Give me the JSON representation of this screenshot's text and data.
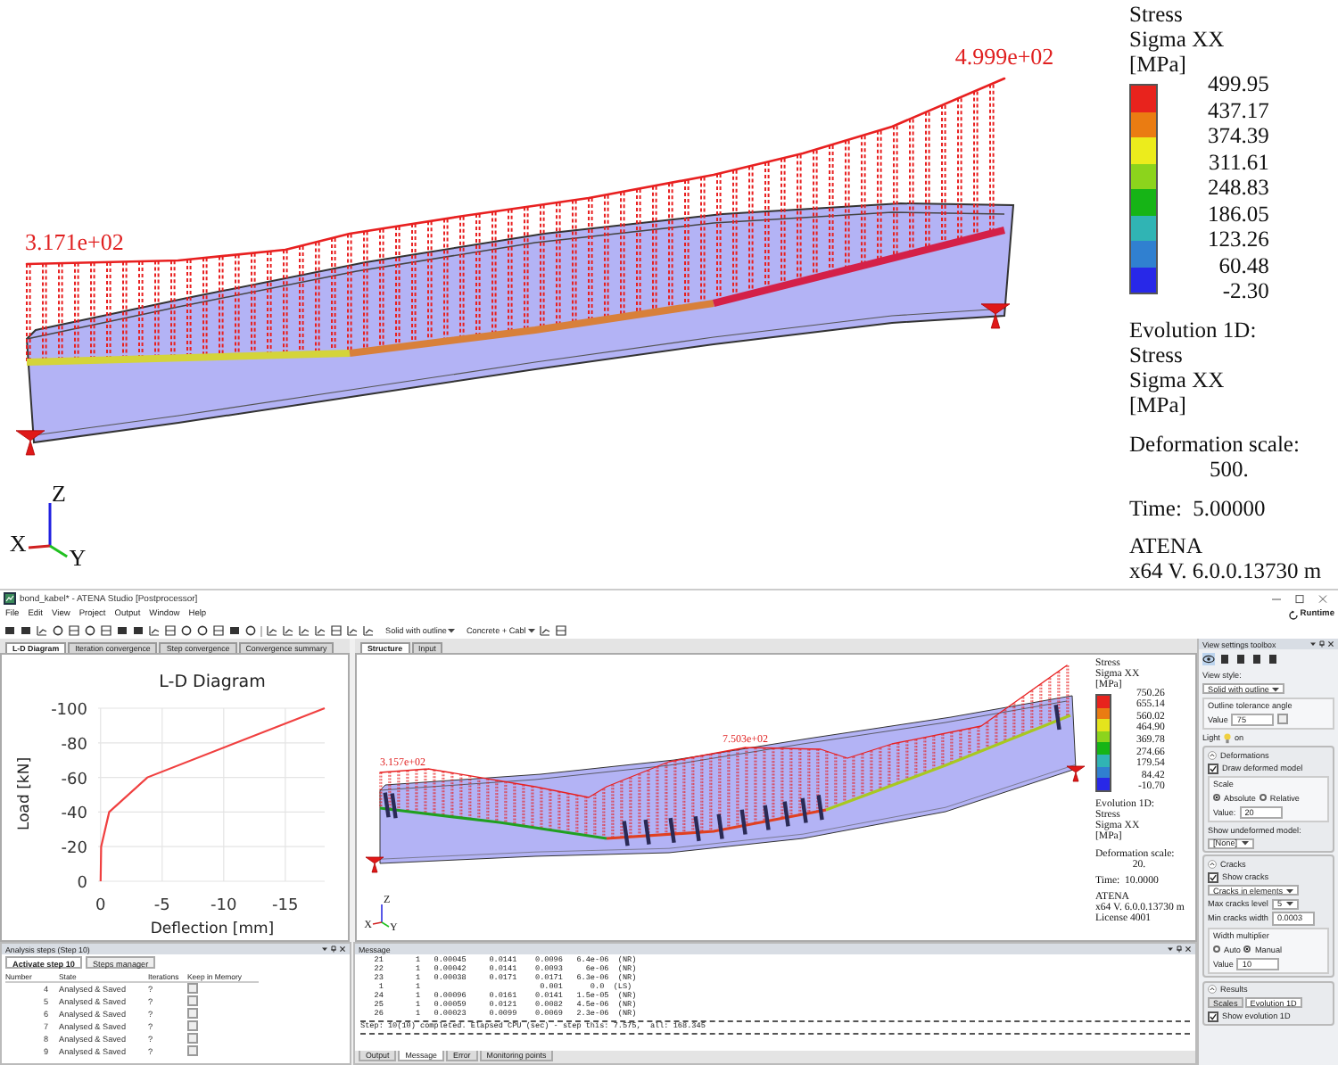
{
  "overview": {
    "viewport": {
      "start_label": "3.171e+02",
      "end_label": "4.999e+02",
      "axes": {
        "z": "Z",
        "x": "X",
        "y": "Y"
      }
    },
    "legend": {
      "title": [
        "Stress",
        "Sigma XX",
        "[MPa]"
      ],
      "values": [
        "499.95",
        "437.17",
        "374.39",
        "311.61",
        "248.83",
        "186.05",
        "123.26",
        "60.48",
        "-2.30"
      ],
      "bands": [
        {
          "color": "#e8231d"
        },
        {
          "color": "#ea7c12"
        },
        {
          "color": "#ecec1c"
        },
        {
          "color": "#8cd41c"
        },
        {
          "color": "#16b416"
        },
        {
          "color": "#30b4b4"
        },
        {
          "color": "#3080d0"
        },
        {
          "color": "#2828e8"
        }
      ],
      "evolution": [
        "Evolution 1D:",
        "Stress",
        "Sigma XX",
        "[MPa]"
      ],
      "deformation_label": "Deformation scale:",
      "deformation_value": "500.",
      "time": "Time:  5.00000",
      "info": [
        "ATENA",
        "x64 V. 6.0.0.13730 m"
      ]
    }
  },
  "app": {
    "window": {
      "title": "bond_kabel* - ATENA Studio [Postprocessor]"
    },
    "menu": [
      "File",
      "Edit",
      "View",
      "Project",
      "Output",
      "Window",
      "Help"
    ],
    "runtime": "Runtime",
    "toolbar": {
      "view_style": "Solid with outline",
      "material": "Concrete + Cabl"
    },
    "left_tabs": [
      {
        "label": "L-D Diagram",
        "selected": true
      },
      {
        "label": "Iteration convergence",
        "selected": false
      },
      {
        "label": "Step convergence",
        "selected": false
      },
      {
        "label": "Convergence summary",
        "selected": false
      }
    ],
    "ld_chart": {
      "chart_data": {
        "type": "line",
        "title": "L-D Diagram",
        "xlabel": "Deflection [mm]",
        "ylabel": "Load [kN]",
        "x": [
          0,
          -0.05,
          -0.7,
          -3.8,
          -18.2
        ],
        "values": [
          0,
          -20,
          -40,
          -60,
          -100
        ],
        "xlim": [
          0.2,
          -18.2
        ],
        "ylim": [
          0,
          -100
        ],
        "xticks": [
          0,
          -5,
          -10,
          -15
        ],
        "yticks": [
          0,
          -20,
          -40,
          -60,
          -80,
          -100
        ],
        "grid": true
      }
    },
    "structure_tabs": [
      {
        "label": "Structure",
        "selected": true
      },
      {
        "label": "Input",
        "selected": false
      }
    ],
    "structure_view": {
      "start_label": "3.157e+02",
      "peak_label": "7.503e+02",
      "axes": {
        "z": "Z",
        "x": "X",
        "y": "Y"
      },
      "legend": {
        "title": [
          "Stress",
          "Sigma XX",
          "[MPa]"
        ],
        "values": [
          "750.26",
          "655.14",
          "560.02",
          "464.90",
          "369.78",
          "274.66",
          "179.54",
          "84.42",
          "-10.70"
        ],
        "bands": [
          {
            "color": "#e8231d"
          },
          {
            "color": "#ea7c12"
          },
          {
            "color": "#e4e41c"
          },
          {
            "color": "#8cd41c"
          },
          {
            "color": "#16b416"
          },
          {
            "color": "#30b4b4"
          },
          {
            "color": "#3080d0"
          },
          {
            "color": "#2828e8"
          }
        ],
        "evolution": [
          "Evolution 1D:",
          "Stress",
          "Sigma XX",
          "[MPa]"
        ],
        "deformation_label": "Deformation scale:",
        "deformation_value": "20.",
        "time": "Time:  10.0000",
        "info": [
          "ATENA",
          "x64 V. 6.0.0.13730 m",
          "License 4001"
        ]
      }
    },
    "toolbox": {
      "title": "View settings toolbox",
      "items": [
        {
          "kind": "label",
          "text": "View style:"
        },
        {
          "kind": "dropdown",
          "value": "Solid with outline"
        },
        {
          "kind": "group",
          "title": "Outline tolerance angle",
          "items": [
            {
              "kind": "field",
              "label": "Value",
              "value": "75",
              "checked": false
            }
          ]
        },
        {
          "kind": "light",
          "label": "Light",
          "value": "on"
        },
        {
          "kind": "section",
          "title": "Deformations",
          "expanded": true,
          "items": [
            {
              "kind": "checkbox",
              "label": "Draw deformed model",
              "checked": true
            },
            {
              "kind": "group",
              "title": "Scale",
              "items": [
                {
                  "kind": "radios",
                  "options": [
                    {
                      "label": "Absolute",
                      "selected": true
                    },
                    {
                      "label": "Relative",
                      "selected": false
                    }
                  ]
                },
                {
                  "kind": "field",
                  "label": "Value:",
                  "value": "20"
                }
              ]
            },
            {
              "kind": "label",
              "text": "Show undeformed model:"
            },
            {
              "kind": "dropdown",
              "value": "[None]"
            }
          ]
        },
        {
          "kind": "section",
          "title": "Cracks",
          "expanded": true,
          "items": [
            {
              "kind": "checkbox",
              "label": "Show cracks",
              "checked": true
            },
            {
              "kind": "dropdown",
              "value": "Cracks in elements"
            },
            {
              "kind": "dropdown",
              "label": "Max cracks level",
              "value": "5"
            },
            {
              "kind": "field",
              "label": "Min cracks width",
              "value": "0.0003"
            },
            {
              "kind": "group",
              "title": "Width multiplier",
              "items": [
                {
                  "kind": "radios",
                  "options": [
                    {
                      "label": "Auto",
                      "selected": false
                    },
                    {
                      "label": "Manual",
                      "selected": true
                    }
                  ]
                },
                {
                  "kind": "field",
                  "label": "Value",
                  "value": "10"
                }
              ]
            }
          ]
        },
        {
          "kind": "section",
          "title": "Results",
          "expanded": true,
          "items": [
            {
              "kind": "tabs",
              "tabs": [
                {
                  "label": "Scales",
                  "selected": false
                },
                {
                  "label": "Evolution 1D",
                  "selected": true
                }
              ]
            },
            {
              "kind": "checkbox",
              "label": "Show evolution 1D",
              "checked": true
            }
          ]
        }
      ]
    },
    "analysis_steps": {
      "title": "Analysis steps (Step 10)",
      "tabs": [
        {
          "label": "Activate step 10",
          "selected": true
        },
        {
          "label": "Steps manager",
          "selected": false
        }
      ],
      "columns": [
        "Number",
        "State",
        "Iterations",
        "Keep in Memory"
      ],
      "rows": [
        {
          "number": "4",
          "state": "Analysed & Saved",
          "iterations": "?",
          "keep_in_memory": false
        },
        {
          "number": "5",
          "state": "Analysed & Saved",
          "iterations": "?",
          "keep_in_memory": false
        },
        {
          "number": "6",
          "state": "Analysed & Saved",
          "iterations": "?",
          "keep_in_memory": false
        },
        {
          "number": "7",
          "state": "Analysed & Saved",
          "iterations": "?",
          "keep_in_memory": false
        },
        {
          "number": "8",
          "state": "Analysed & Saved",
          "iterations": "?",
          "keep_in_memory": false
        },
        {
          "number": "9",
          "state": "Analysed & Saved",
          "iterations": "?",
          "keep_in_memory": false
        }
      ]
    },
    "message": {
      "title": "Message",
      "lines": [
        "   21       1   0.00045     0.0141    0.0096   6.4e-06  (NR)",
        "   22       1   0.00042     0.0141    0.0093     6e-06  (NR)",
        "   23       1   0.00038     0.0171    0.0171   6.3e-06  (NR)",
        "    1       1                          0.001      0.0  (LS)",
        "   24       1   0.00096     0.0161    0.0141   1.5e-05  (NR)",
        "   25       1   0.00059     0.0121    0.0082   4.5e-06  (NR)",
        "   26       1   0.00023     0.0099    0.0069   2.3e-06  (NR)"
      ],
      "summary": "Step: 10(10) completed. Elapsed CPU (sec) - step this: 7.575,  all: 168.345",
      "tabs": [
        {
          "label": "Output",
          "selected": false
        },
        {
          "label": "Message",
          "selected": true
        },
        {
          "label": "Error",
          "selected": false
        },
        {
          "label": "Monitoring points",
          "selected": false
        }
      ]
    }
  }
}
